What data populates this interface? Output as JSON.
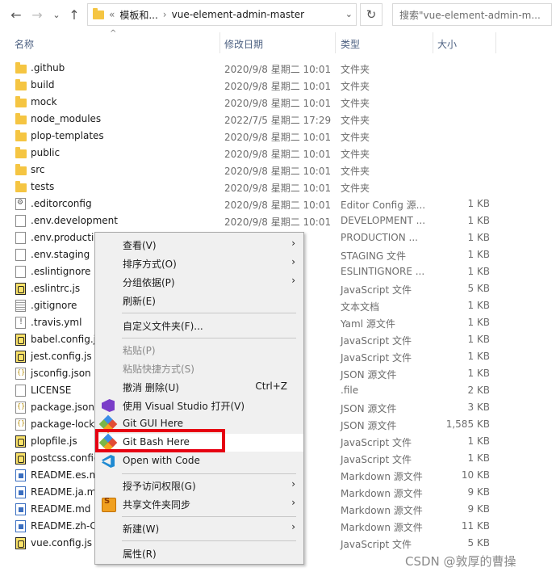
{
  "toolbar": {
    "back_icon": "left-arrow-icon",
    "forward_icon": "right-arrow-icon",
    "dropdown_icon": "chevron-down-icon",
    "up_icon": "up-arrow-icon"
  },
  "address": {
    "overflow": "«",
    "crumb1": "模板和...",
    "separator": "›",
    "crumb2": "vue-element-admin-master",
    "dropdown": "⌄"
  },
  "refresh": "↻",
  "search": {
    "placeholder": "搜索\"vue-element-admin-m..."
  },
  "columns": {
    "name": "名称",
    "date": "修改日期",
    "type": "类型",
    "size": "大小"
  },
  "files": [
    {
      "name": ".github",
      "date": "2020/9/8 星期二 10:01",
      "type": "文件夹",
      "size": "",
      "icon": "folder"
    },
    {
      "name": "build",
      "date": "2020/9/8 星期二 10:01",
      "type": "文件夹",
      "size": "",
      "icon": "folder"
    },
    {
      "name": "mock",
      "date": "2020/9/8 星期二 10:01",
      "type": "文件夹",
      "size": "",
      "icon": "folder"
    },
    {
      "name": "node_modules",
      "date": "2022/7/5 星期二 17:29",
      "type": "文件夹",
      "size": "",
      "icon": "folder"
    },
    {
      "name": "plop-templates",
      "date": "2020/9/8 星期二 10:01",
      "type": "文件夹",
      "size": "",
      "icon": "folder"
    },
    {
      "name": "public",
      "date": "2020/9/8 星期二 10:01",
      "type": "文件夹",
      "size": "",
      "icon": "folder"
    },
    {
      "name": "src",
      "date": "2020/9/8 星期二 10:01",
      "type": "文件夹",
      "size": "",
      "icon": "folder"
    },
    {
      "name": "tests",
      "date": "2020/9/8 星期二 10:01",
      "type": "文件夹",
      "size": "",
      "icon": "folder"
    },
    {
      "name": ".editorconfig",
      "date": "2020/9/8 星期二 10:01",
      "type": "Editor Config 源...",
      "size": "1 KB",
      "icon": "gear"
    },
    {
      "name": ".env.development",
      "date": "2020/9/8 星期二 10:01",
      "type": "DEVELOPMENT ...",
      "size": "1 KB",
      "icon": "file"
    },
    {
      "name": ".env.productio",
      "date": "10:01",
      "type": "PRODUCTION ...",
      "size": "1 KB",
      "icon": "file"
    },
    {
      "name": ".env.staging",
      "date": "10:01",
      "type": "STAGING 文件",
      "size": "1 KB",
      "icon": "file"
    },
    {
      "name": ".eslintignore",
      "date": "10:01",
      "type": "ESLINTIGNORE ...",
      "size": "1 KB",
      "icon": "file"
    },
    {
      "name": ".eslintrc.js",
      "date": "10:01",
      "type": "JavaScript 文件",
      "size": "5 KB",
      "icon": "js"
    },
    {
      "name": ".gitignore",
      "date": "10:01",
      "type": "文本文档",
      "size": "1 KB",
      "icon": "text"
    },
    {
      "name": ".travis.yml",
      "date": "10:01",
      "type": "Yaml 源文件",
      "size": "1 KB",
      "icon": "exc"
    },
    {
      "name": "babel.config.j",
      "date": "10:01",
      "type": "JavaScript 文件",
      "size": "1 KB",
      "icon": "js"
    },
    {
      "name": "jest.config.js",
      "date": "10:01",
      "type": "JavaScript 文件",
      "size": "1 KB",
      "icon": "js"
    },
    {
      "name": "jsconfig.json",
      "date": "10:01",
      "type": "JSON 源文件",
      "size": "1 KB",
      "icon": "json"
    },
    {
      "name": "LICENSE",
      "date": "10:01",
      "type": ".file",
      "size": "2 KB",
      "icon": "file"
    },
    {
      "name": "package.json",
      "date": "10:01",
      "type": "JSON 源文件",
      "size": "3 KB",
      "icon": "json"
    },
    {
      "name": "package-lock",
      "date": "17:20",
      "type": "JSON 源文件",
      "size": "1,585 KB",
      "icon": "json"
    },
    {
      "name": "plopfile.js",
      "date": "10:01",
      "type": "JavaScript 文件",
      "size": "1 KB",
      "icon": "js"
    },
    {
      "name": "postcss.config",
      "date": "10:01",
      "type": "JavaScript 文件",
      "size": "1 KB",
      "icon": "js"
    },
    {
      "name": "README.es.m",
      "date": "10:01",
      "type": "Markdown 源文件",
      "size": "10 KB",
      "icon": "md"
    },
    {
      "name": "README.ja.m",
      "date": "10:01",
      "type": "Markdown 源文件",
      "size": "9 KB",
      "icon": "md"
    },
    {
      "name": "README.md",
      "date": "10:01",
      "type": "Markdown 源文件",
      "size": "9 KB",
      "icon": "md"
    },
    {
      "name": "README.zh-C",
      "date": "10:01",
      "type": "Markdown 源文件",
      "size": "11 KB",
      "icon": "md"
    },
    {
      "name": "vue.config.js",
      "date": "10:01",
      "type": "JavaScript 文件",
      "size": "5 KB",
      "icon": "js"
    }
  ],
  "menu": {
    "view": "查看(V)",
    "sort": "排序方式(O)",
    "group": "分组依据(P)",
    "refresh": "刷新(E)",
    "customize": "自定义文件夹(F)...",
    "paste": "粘贴(P)",
    "paste_shortcut": "粘贴快捷方式(S)",
    "undo": "撤消 删除(U)",
    "undo_key": "Ctrl+Z",
    "vs": "使用 Visual Studio 打开(V)",
    "git_gui": "Git GUI Here",
    "git_bash": "Git Bash Here",
    "open_code": "Open with Code",
    "grant": "授予访问权限(G)",
    "share": "共享文件夹同步",
    "new": "新建(W)",
    "properties": "属性(R)",
    "arrow": "›"
  },
  "watermark": "CSDN @敦厚的曹操"
}
